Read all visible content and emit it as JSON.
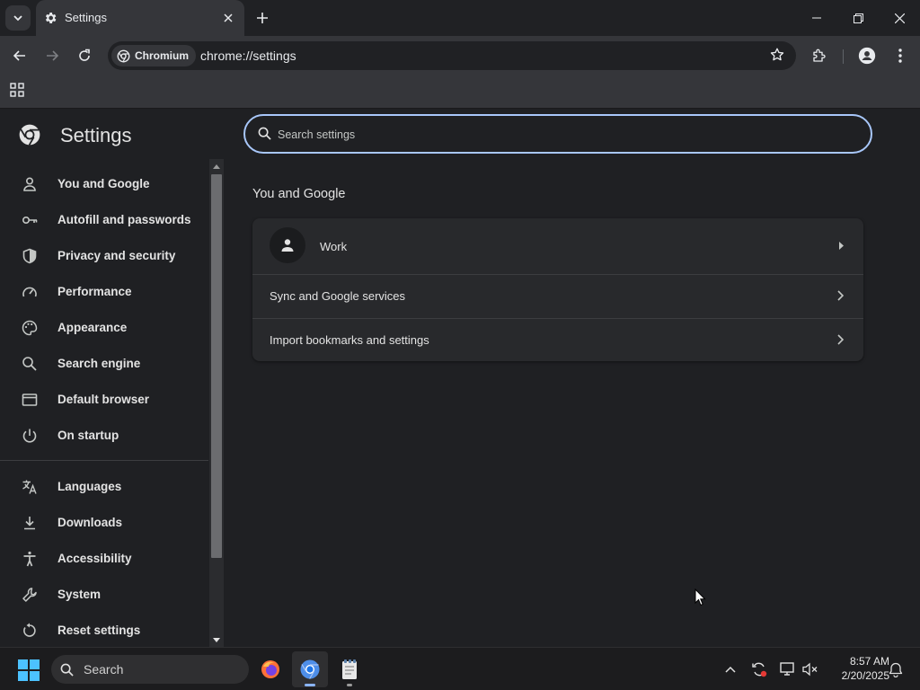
{
  "tab": {
    "title": "Settings"
  },
  "omnibox": {
    "chip_label": "Chromium",
    "url": "chrome://settings"
  },
  "page": {
    "title": "Settings",
    "search_placeholder": "Search settings",
    "section_title": "You and Google"
  },
  "sidebar": {
    "items": [
      {
        "label": "You and Google",
        "icon": "person-icon"
      },
      {
        "label": "Autofill and passwords",
        "icon": "key-icon"
      },
      {
        "label": "Privacy and security",
        "icon": "shield-icon"
      },
      {
        "label": "Performance",
        "icon": "speedometer-icon"
      },
      {
        "label": "Appearance",
        "icon": "palette-icon"
      },
      {
        "label": "Search engine",
        "icon": "search-icon"
      },
      {
        "label": "Default browser",
        "icon": "browser-window-icon"
      },
      {
        "label": "On startup",
        "icon": "power-icon"
      },
      {
        "label": "Languages",
        "icon": "translate-icon"
      },
      {
        "label": "Downloads",
        "icon": "download-icon"
      },
      {
        "label": "Accessibility",
        "icon": "accessibility-icon"
      },
      {
        "label": "System",
        "icon": "wrench-icon"
      },
      {
        "label": "Reset settings",
        "icon": "reset-icon"
      }
    ]
  },
  "card": {
    "rows": [
      {
        "label": "Work"
      },
      {
        "label": "Sync and Google services"
      },
      {
        "label": "Import bookmarks and settings"
      }
    ]
  },
  "taskbar": {
    "search_label": "Search",
    "time": "8:57 AM",
    "date": "2/20/2025"
  },
  "colors": {
    "accent": "#a8c7fa",
    "background": "#1f2023",
    "card": "#28292c"
  }
}
